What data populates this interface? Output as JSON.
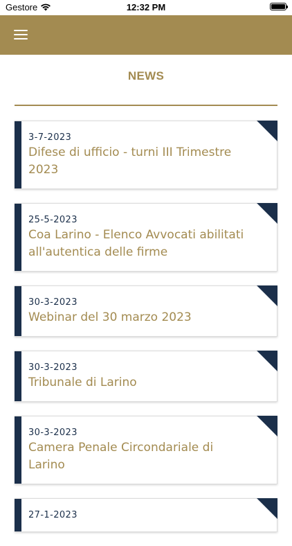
{
  "status_bar": {
    "carrier": "Gestore",
    "time": "12:32 PM"
  },
  "header": {
    "menu_icon": "hamburger-icon"
  },
  "page": {
    "title": "NEWS"
  },
  "news": [
    {
      "date": "3-7-2023",
      "title": "Difese di ufficio - turni III Trimestre 2023"
    },
    {
      "date": "25-5-2023",
      "title": "Coa Larino - Elenco Avvocati abilitati all'autentica delle firme"
    },
    {
      "date": "30-3-2023",
      "title": "Webinar del 30 marzo 2023"
    },
    {
      "date": "30-3-2023",
      "title": "Tribunale di Larino"
    },
    {
      "date": "30-3-2023",
      "title": "Camera Penale Circondariale di Larino"
    },
    {
      "date": "27-1-2023",
      "title": ""
    }
  ],
  "colors": {
    "gold": "#a38b51",
    "navy": "#1b2f4a"
  }
}
